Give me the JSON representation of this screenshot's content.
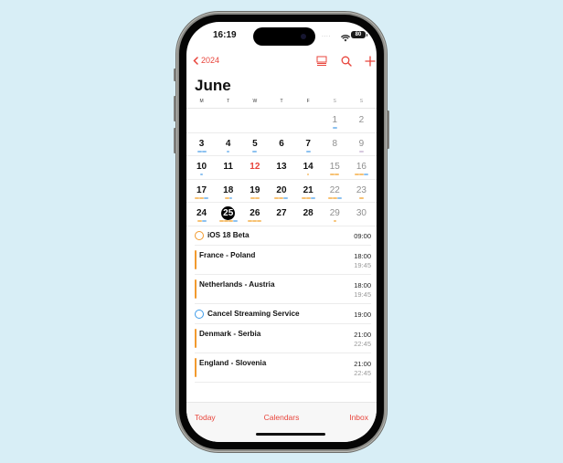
{
  "status_bar": {
    "time": "16:19",
    "signal": "....",
    "wifi_icon": "wifi-icon",
    "battery_level": "80"
  },
  "nav": {
    "back_label": "2024",
    "back_icon": "chevron-left-icon",
    "icons": [
      "list-view-icon",
      "search-icon",
      "plus-icon"
    ]
  },
  "calendar": {
    "month_title": "June",
    "weekdays": [
      "M",
      "T",
      "W",
      "T",
      "F",
      "S",
      "S"
    ],
    "weeks": [
      [
        {
          "day": ""
        },
        {
          "day": ""
        },
        {
          "day": ""
        },
        {
          "day": ""
        },
        {
          "day": ""
        },
        {
          "day": "1",
          "weekend": true,
          "dots": [
            "blue"
          ]
        },
        {
          "day": "2",
          "weekend": true,
          "dots": []
        }
      ],
      [
        {
          "day": "3",
          "dots": [
            "blue",
            "blue"
          ]
        },
        {
          "day": "4",
          "dots": [
            "blue-dot"
          ]
        },
        {
          "day": "5",
          "dots": [
            "blue"
          ]
        },
        {
          "day": "6",
          "dots": []
        },
        {
          "day": "7",
          "dots": [
            "blue"
          ]
        },
        {
          "day": "8",
          "weekend": true,
          "dots": []
        },
        {
          "day": "9",
          "weekend": true,
          "dots": [
            "gray"
          ]
        }
      ],
      [
        {
          "day": "10",
          "dots": [
            "blue-dot"
          ]
        },
        {
          "day": "11",
          "dots": []
        },
        {
          "day": "12",
          "red": true,
          "dots": []
        },
        {
          "day": "13",
          "dots": []
        },
        {
          "day": "14",
          "dots": [
            "orange-dot"
          ]
        },
        {
          "day": "15",
          "weekend": true,
          "dots": [
            "orange",
            "orange"
          ]
        },
        {
          "day": "16",
          "weekend": true,
          "dots": [
            "orange",
            "orange",
            "blue"
          ]
        }
      ],
      [
        {
          "day": "17",
          "dots": [
            "orange",
            "orange",
            "blue"
          ]
        },
        {
          "day": "18",
          "dots": [
            "orange",
            "blue-short"
          ]
        },
        {
          "day": "19",
          "dots": [
            "orange",
            "orange"
          ]
        },
        {
          "day": "20",
          "dots": [
            "orange",
            "orange",
            "blue"
          ]
        },
        {
          "day": "21",
          "dots": [
            "orange",
            "orange",
            "blue"
          ]
        },
        {
          "day": "22",
          "weekend": true,
          "dots": [
            "orange",
            "orange",
            "blue"
          ]
        },
        {
          "day": "23",
          "weekend": true,
          "dots": [
            "orange"
          ]
        }
      ],
      [
        {
          "day": "24",
          "dots": [
            "orange",
            "blue"
          ]
        },
        {
          "day": "25",
          "selected": true,
          "dots": [
            "orange",
            "orange",
            "orange",
            "blue"
          ]
        },
        {
          "day": "26",
          "dots": [
            "orange",
            "orange",
            "orange"
          ]
        },
        {
          "day": "27",
          "dots": []
        },
        {
          "day": "28",
          "dots": []
        },
        {
          "day": "29",
          "weekend": true,
          "dots": [
            "orange-dot"
          ]
        },
        {
          "day": "30",
          "weekend": true,
          "dots": []
        }
      ]
    ]
  },
  "events": [
    {
      "title": "iOS 18 Beta",
      "start": "09:00",
      "end": "",
      "kind": "reminder",
      "color": "#f29a2e"
    },
    {
      "title": "France - Poland",
      "start": "18:00",
      "end": "19:45",
      "kind": "event",
      "color": "#f29a2e"
    },
    {
      "title": "Netherlands - Austria",
      "start": "18:00",
      "end": "19:45",
      "kind": "event",
      "color": "#f29a2e"
    },
    {
      "title": "Cancel Streaming Service",
      "start": "19:00",
      "end": "",
      "kind": "reminder",
      "color": "#3d9be9"
    },
    {
      "title": "Denmark - Serbia",
      "start": "21:00",
      "end": "22:45",
      "kind": "event",
      "color": "#f29a2e"
    },
    {
      "title": "England - Slovenia",
      "start": "21:00",
      "end": "22:45",
      "kind": "event",
      "color": "#f29a2e"
    }
  ],
  "tabbar": {
    "today": "Today",
    "calendars": "Calendars",
    "inbox": "Inbox"
  },
  "colors": {
    "accent": "#e8453c",
    "orange": "#f7c273",
    "blue": "#8cc2f0",
    "gray": "#d6c8de"
  }
}
